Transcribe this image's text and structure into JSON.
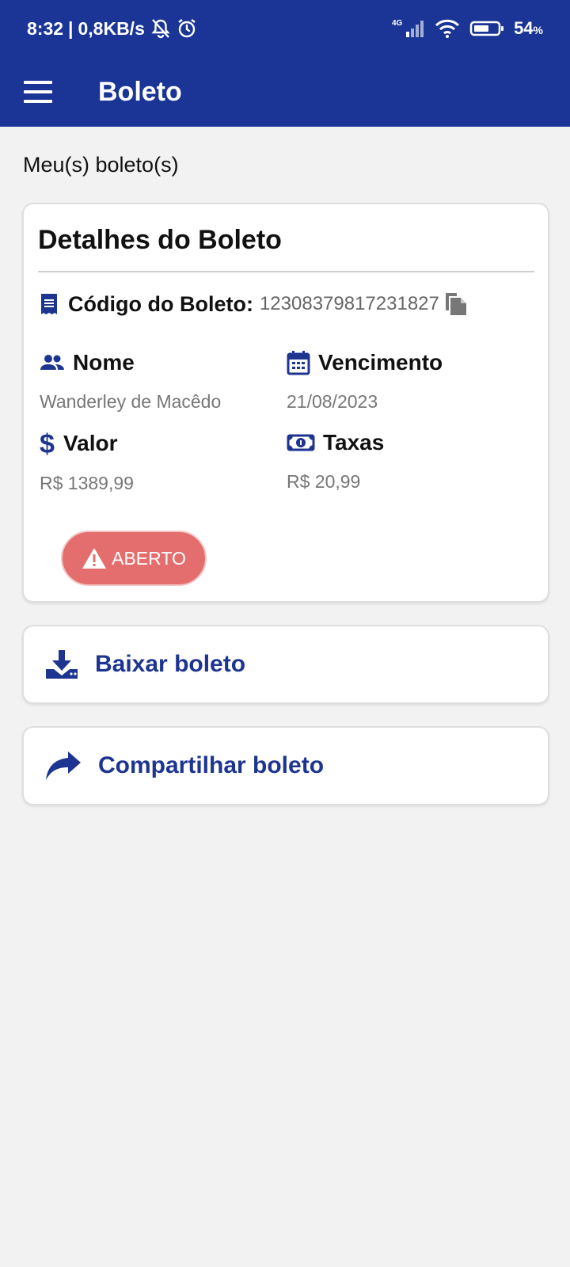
{
  "status_bar": {
    "time": "8:32",
    "speed": "0,8KB/s",
    "network": "4G",
    "battery": "54",
    "battery_unit": "%"
  },
  "app_bar": {
    "title": "Boleto",
    "menu_icon": "menu-icon"
  },
  "section_label": "Meu(s) boleto(s)",
  "details": {
    "title": "Detalhes do Boleto",
    "code_label": "Código do Boleto:",
    "code_value": "12308379817231827",
    "fields": {
      "nome": {
        "label": "Nome",
        "value": "Wanderley de Macêdo",
        "icon": "people-icon"
      },
      "vencimento": {
        "label": "Vencimento",
        "value": "21/08/2023",
        "icon": "calendar-icon"
      },
      "valor": {
        "label": "Valor",
        "value": "R$ 1389,99",
        "icon": "dollar-icon"
      },
      "taxas": {
        "label": "Taxas",
        "value": "R$ 20,99",
        "icon": "money-icon"
      }
    },
    "status": "ABERTO",
    "status_color": "#e46e6e"
  },
  "actions": {
    "download": "Baixar boleto",
    "share": "Compartilhar boleto"
  },
  "colors": {
    "primary": "#1a3595",
    "background": "#f2f2f2",
    "action_text": "#1d3590"
  }
}
